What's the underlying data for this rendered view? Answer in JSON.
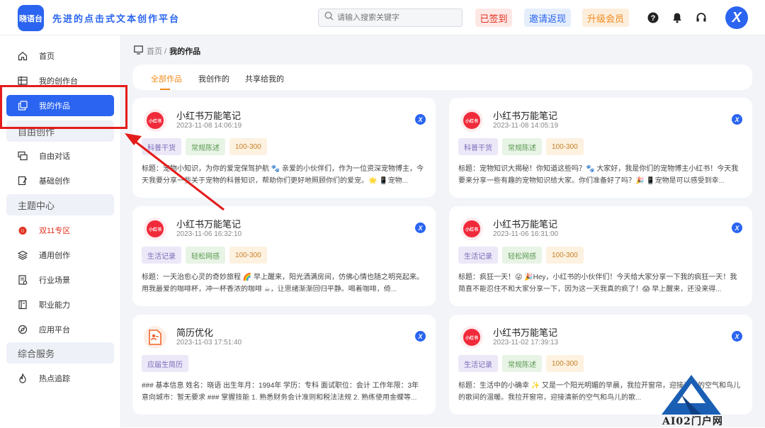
{
  "header": {
    "logo_text": "晓语台",
    "slogan": "先进的点击式文本创作平台",
    "search_placeholder": "请输入搜索关键字",
    "signed_in_label": "已签到",
    "invite_label": "邀请返现",
    "upgrade_label": "升级会员",
    "avatar_text": "X",
    "colors": {
      "brand": "#2a64f0",
      "signed": "#e0301e",
      "upgrade": "#f08a1c"
    }
  },
  "sidebar": {
    "home": "首页",
    "my_platform": "我的创作台",
    "my_works": "我的作品",
    "section_free": "自由创作",
    "free_chat": "自由对话",
    "basic_create": "基础创作",
    "section_theme": "主题中心",
    "double11": "双11专区",
    "general_create": "通用创作",
    "industry": "行业场景",
    "career": "职业能力",
    "app_platform": "应用平台",
    "section_service": "综合服务",
    "hot_track": "热点追踪"
  },
  "breadcrumb": {
    "home": "首页 /",
    "current": "我的作品"
  },
  "tabs": {
    "all": "全部作品",
    "mine": "我创作的",
    "shared": "共享给我的"
  },
  "cards": [
    {
      "title": "小红书万能笔记",
      "date": "2023-11-08 14:06:19",
      "tags": [
        "科普干货",
        "常规陈述",
        "100-300"
      ],
      "desc": "标题：宠物小知识，为你的爱宠保驾护航 🐾 亲爱的小伙伴们，作为一位资深宠物博主，今天我要分享一些关于宠物的科普知识，帮助你们更好地照顾你们的爱宠。🌟 📱宠物..."
    },
    {
      "title": "小红书万能笔记",
      "date": "2023-11-08 14:05:19",
      "tags": [
        "科普干货",
        "常规陈述",
        "100-300"
      ],
      "desc": "标题：宠物知识大揭秘！你知道这些吗？🐾 大家好，我是你们的宠物博主小红书！今天我要来分享一些有趣的宠物知识给大家。你们准备好了吗？🎉 📱宠物是可以感受到幸..."
    },
    {
      "title": "小红书万能笔记",
      "date": "2023-11-06 16:32:10",
      "tags": [
        "生活记录",
        "轻松网感",
        "100-300"
      ],
      "desc": "标题：一天治愈心灵的奇妙旅程 🌈 早上醒来，阳光洒满房间，仿佛心情也随之明亮起来。用我最爱的咖啡杯，冲一杯香浓的咖啡 ☕，让思绪渐渐回归平静。喝着咖啡，倚..."
    },
    {
      "title": "小红书万能笔记",
      "date": "2023-11-06 16:31:00",
      "tags": [
        "生活记录",
        "轻松网感",
        "100-300"
      ],
      "desc": "标题：疯狂一天！😜 🎉Hey，小红书的小伙伴们！今天给大家分享一下我的疯狂一天！我简直不能忍住不和大家分享一下，因为这一天我真的疯了！😱 早上醒来，还没来得..."
    },
    {
      "title": "简历优化",
      "date": "2023-11-03 17:51:40",
      "tags": [
        "应届生简历"
      ],
      "desc": "### 基本信息 姓名：晓语 出生年月：1994年 学历：专科 面试职位：会计 工作年限：3年 意向城市：暂无要求 ### 掌握技能 1. 熟悉财务会计准则和税法法规 2. 熟练使用金蝶等..."
    },
    {
      "title": "小红书万能笔记",
      "date": "2023-11-02 17:39:13",
      "tags": [
        "生活记录",
        "常规陈述",
        "100-300"
      ],
      "desc": "标题：生活中的小确幸 ✨ 又是一个阳光明媚的早晨，我拉开窗帘，迎接清新的空气和鸟儿的歌间的温暖。我拉开窗帘，迎接清新的空气和鸟儿的歌..."
    }
  ],
  "card_icon_text": "小红书",
  "card_badge": "X",
  "watermark": "AI02门户网"
}
